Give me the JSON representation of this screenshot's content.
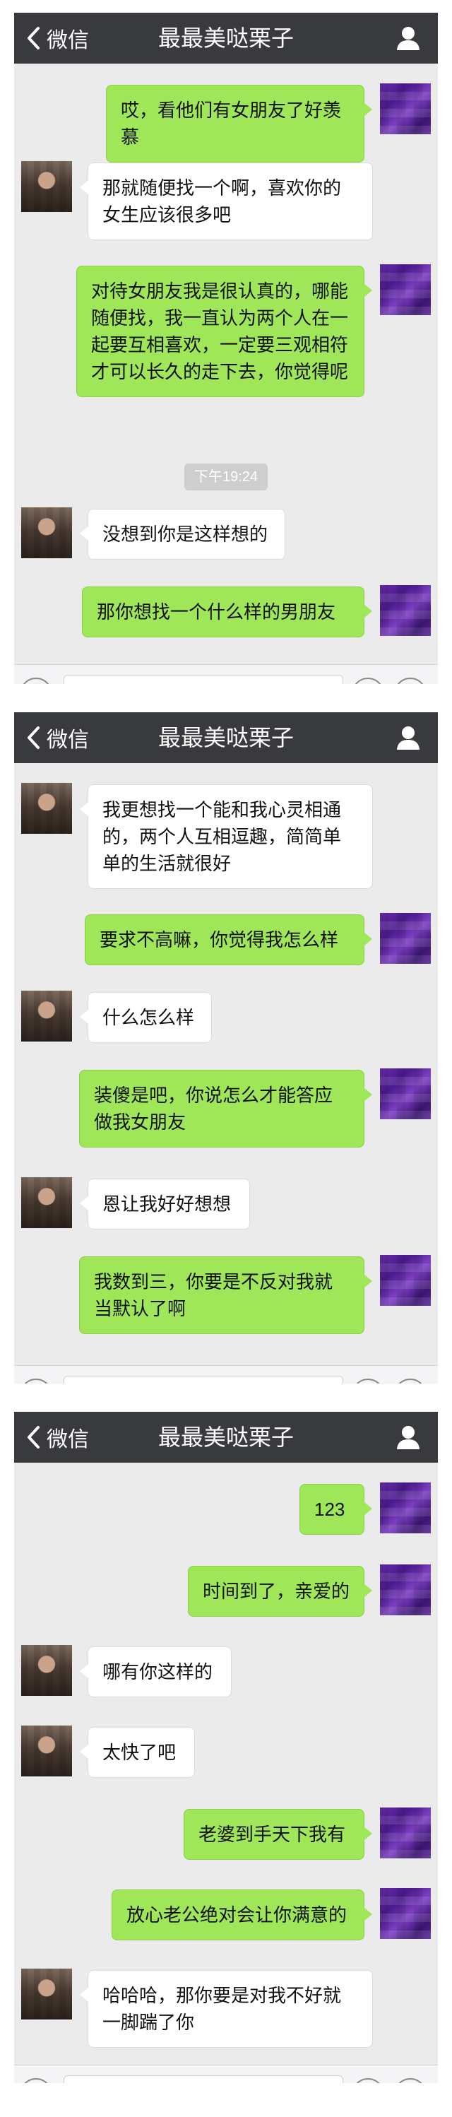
{
  "panels": [
    {
      "header": {
        "back_label": "微信",
        "title": "最最美哒栗子"
      },
      "messages": [
        {
          "side": "right",
          "text": "哎，看他们有女朋友了好羡慕"
        },
        {
          "side": "left",
          "text": "那就随便找一个啊，喜欢你的女生应该很多吧"
        },
        {
          "side": "right",
          "text": "对待女朋友我是很认真的，哪能随便找，我一直认为两个人在一起要互相喜欢，一定要三观相符才可以长久的走下去，你觉得呢"
        },
        {
          "side": "time",
          "text": "下午19:24"
        },
        {
          "side": "left",
          "text": "没想到你是这样想的"
        },
        {
          "side": "right",
          "text": "那你想找一个什么样的男朋友"
        }
      ]
    },
    {
      "header": {
        "back_label": "微信",
        "title": "最最美哒栗子"
      },
      "messages": [
        {
          "side": "left",
          "text": "我更想找一个能和我心灵相通的，两个人互相逗趣，简简单单的生活就很好"
        },
        {
          "side": "right",
          "text": "要求不高嘛，你觉得我怎么样"
        },
        {
          "side": "left",
          "text": "什么怎么样"
        },
        {
          "side": "right",
          "text": "装傻是吧，你说怎么才能答应做我女朋友"
        },
        {
          "side": "left",
          "text": "恩让我好好想想"
        },
        {
          "side": "right",
          "text": "我数到三，你要是不反对我就当默认了啊"
        }
      ]
    },
    {
      "header": {
        "back_label": "微信",
        "title": "最最美哒栗子"
      },
      "messages": [
        {
          "side": "right",
          "text": "123"
        },
        {
          "side": "right",
          "text": "时间到了，亲爱的"
        },
        {
          "side": "left",
          "text": "哪有你这样的"
        },
        {
          "side": "left",
          "text": "太快了吧"
        },
        {
          "side": "right",
          "text": "老婆到手天下我有"
        },
        {
          "side": "right",
          "text": "放心老公绝对会让你满意的"
        },
        {
          "side": "left",
          "text": "哈哈哈，那你要是对我不好就一脚踹了你"
        }
      ]
    }
  ],
  "icons": {
    "back": "chevron-left-icon",
    "profile": "person-icon",
    "voice": "voice-icon",
    "emoji": "emoji-icon",
    "plus": "plus-icon"
  },
  "colors": {
    "titlebar": "#393a3e",
    "chat_background": "#ebebeb",
    "sent_bubble": "#9fe658",
    "received_bubble": "#ffffff",
    "time_chip": "#cecece"
  }
}
